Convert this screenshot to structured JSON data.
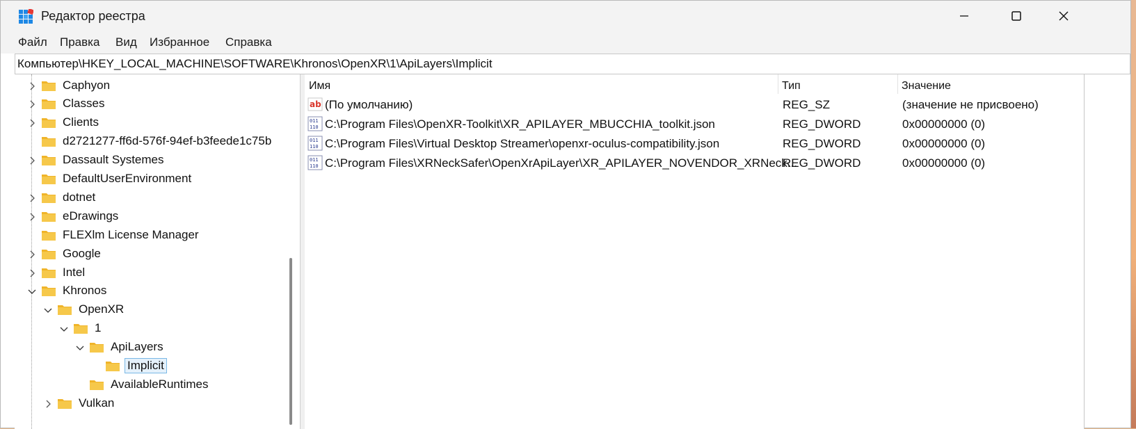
{
  "window": {
    "title": "Редактор реестра",
    "controls": {
      "minimize": "minimize",
      "maximize": "maximize",
      "close": "close"
    }
  },
  "menu": [
    "Файл",
    "Правка",
    "Вид",
    "Избранное",
    "Справка"
  ],
  "address": "Компьютер\\HKEY_LOCAL_MACHINE\\SOFTWARE\\Khronos\\OpenXR\\1\\ApiLayers\\Implicit",
  "tree": [
    {
      "label": "Caphyon",
      "expander": "collapsed"
    },
    {
      "label": "Classes",
      "expander": "collapsed"
    },
    {
      "label": "Clients",
      "expander": "collapsed"
    },
    {
      "label": "d2721277-ff6d-576f-94ef-b3feede1c75b",
      "expander": "none"
    },
    {
      "label": "Dassault Systemes",
      "expander": "collapsed"
    },
    {
      "label": "DefaultUserEnvironment",
      "expander": "none"
    },
    {
      "label": "dotnet",
      "expander": "collapsed"
    },
    {
      "label": "eDrawings",
      "expander": "collapsed"
    },
    {
      "label": "FLEXlm License Manager",
      "expander": "none"
    },
    {
      "label": "Google",
      "expander": "collapsed"
    },
    {
      "label": "Intel",
      "expander": "collapsed"
    },
    {
      "label": "Khronos",
      "expander": "expanded"
    },
    {
      "label": "OpenXR",
      "expander": "expanded"
    },
    {
      "label": "1",
      "expander": "expanded"
    },
    {
      "label": "ApiLayers",
      "expander": "expanded"
    },
    {
      "label": "Implicit",
      "expander": "none",
      "selected": true
    },
    {
      "label": "AvailableRuntimes",
      "expander": "none"
    },
    {
      "label": "Vulkan",
      "expander": "collapsed"
    }
  ],
  "list": {
    "columns": [
      "Имя",
      "Тип",
      "Значение"
    ],
    "rows": [
      {
        "icon": "string-value-icon",
        "name": "(По умолчанию)",
        "type": "REG_SZ",
        "value": "(значение не присвоено)"
      },
      {
        "icon": "binary-value-icon",
        "name": "C:\\Program Files\\OpenXR-Toolkit\\XR_APILAYER_MBUCCHIA_toolkit.json",
        "type": "REG_DWORD",
        "value": "0x00000000 (0)"
      },
      {
        "icon": "binary-value-icon",
        "name": "C:\\Program Files\\Virtual Desktop Streamer\\openxr-oculus-compatibility.json",
        "type": "REG_DWORD",
        "value": "0x00000000 (0)"
      },
      {
        "icon": "binary-value-icon",
        "name": "C:\\Program Files\\XRNeckSafer\\OpenXrApiLayer\\XR_APILAYER_NOVENDOR_XRNeck...",
        "type": "REG_DWORD",
        "value": "0x00000000 (0)"
      }
    ]
  },
  "colors": {
    "folder": "#f6c84a",
    "selection_bg": "#e5f1fb",
    "selection_border": "#7ab8e6",
    "titlebar_bg": "#f3f3f3"
  }
}
